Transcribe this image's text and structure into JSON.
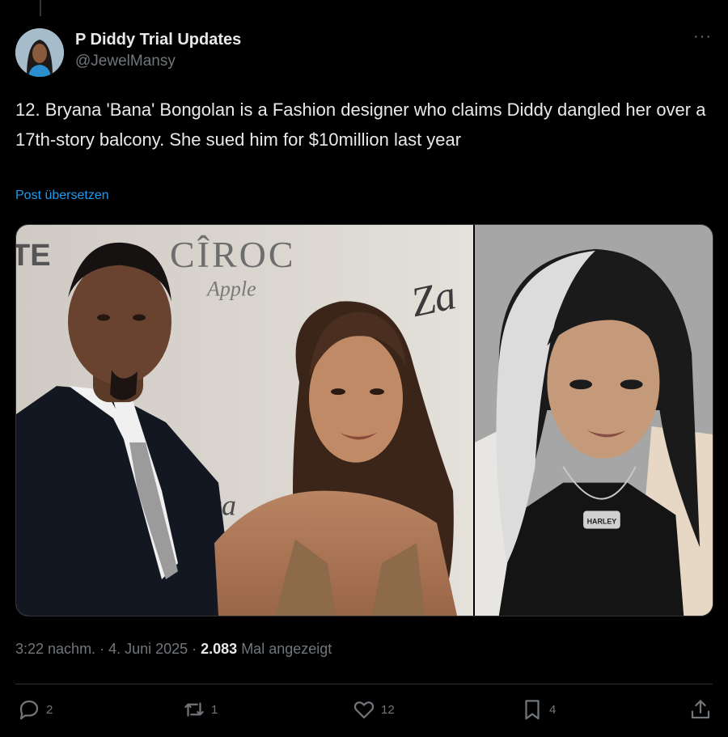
{
  "author": {
    "display_name": "P Diddy Trial Updates",
    "handle": "@JewelMansy"
  },
  "tweet": {
    "text": "12. Bryana 'Bana' Bongolan is a Fashion designer who claims Diddy dangled her over a 17th-story balcony.  She sued him for $10million last year",
    "translate_label": "Post übersetzen"
  },
  "media": {
    "left_photo_backdrop_text": [
      "TE",
      "CÎROC",
      "Apple",
      "Za",
      "aca"
    ],
    "right_photo_shirt_text": "HARLEY"
  },
  "meta": {
    "time": "3:22 nachm.",
    "sep1": " · ",
    "date": "4. Juni 2025",
    "sep2": " · ",
    "views_count": "2.083",
    "views_label": " Mal angezeigt"
  },
  "actions": {
    "reply_count": "2",
    "repost_count": "1",
    "like_count": "12",
    "bookmark_count": "4"
  },
  "icons": {
    "more": "more-icon",
    "reply": "reply-icon",
    "repost": "repost-icon",
    "like": "heart-icon",
    "bookmark": "bookmark-icon",
    "share": "share-icon"
  },
  "colors": {
    "background": "#000000",
    "text": "#e7e9ea",
    "secondary": "#71767b",
    "link": "#1d9bf0"
  }
}
